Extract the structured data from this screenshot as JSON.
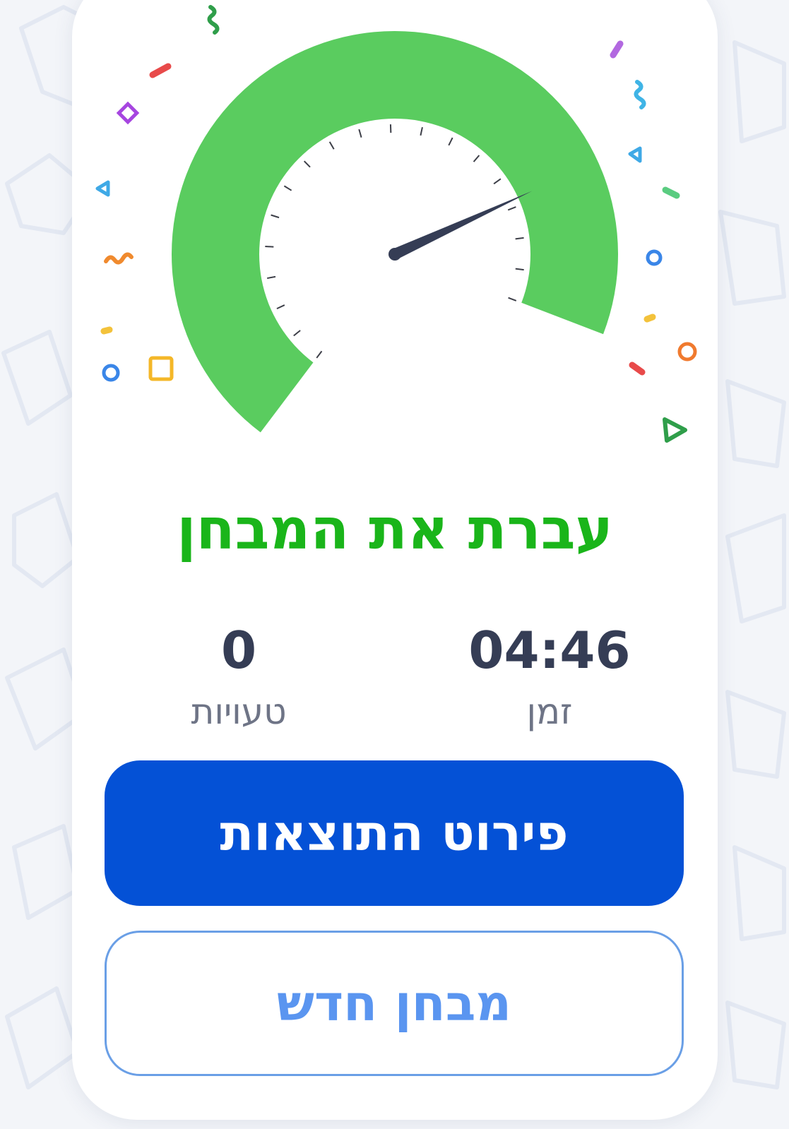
{
  "result": {
    "title": "עברת את המבחן",
    "status": "passed"
  },
  "gauge": {
    "passed_color": "#5acc5f",
    "needle_color": "#353d55",
    "needle_value": 0.82
  },
  "stats": {
    "time": {
      "value": "04:46",
      "label": "זמן"
    },
    "errors": {
      "value": "0",
      "label": "טעויות"
    }
  },
  "buttons": {
    "results_details": "פירוט התוצאות",
    "new_test": "מבחן חדש"
  },
  "colors": {
    "title_green": "#1ab51a",
    "primary_blue": "#0451d6",
    "secondary_blue": "#5a95f0",
    "text_dark": "#353d55",
    "text_gray": "#6e7486"
  }
}
